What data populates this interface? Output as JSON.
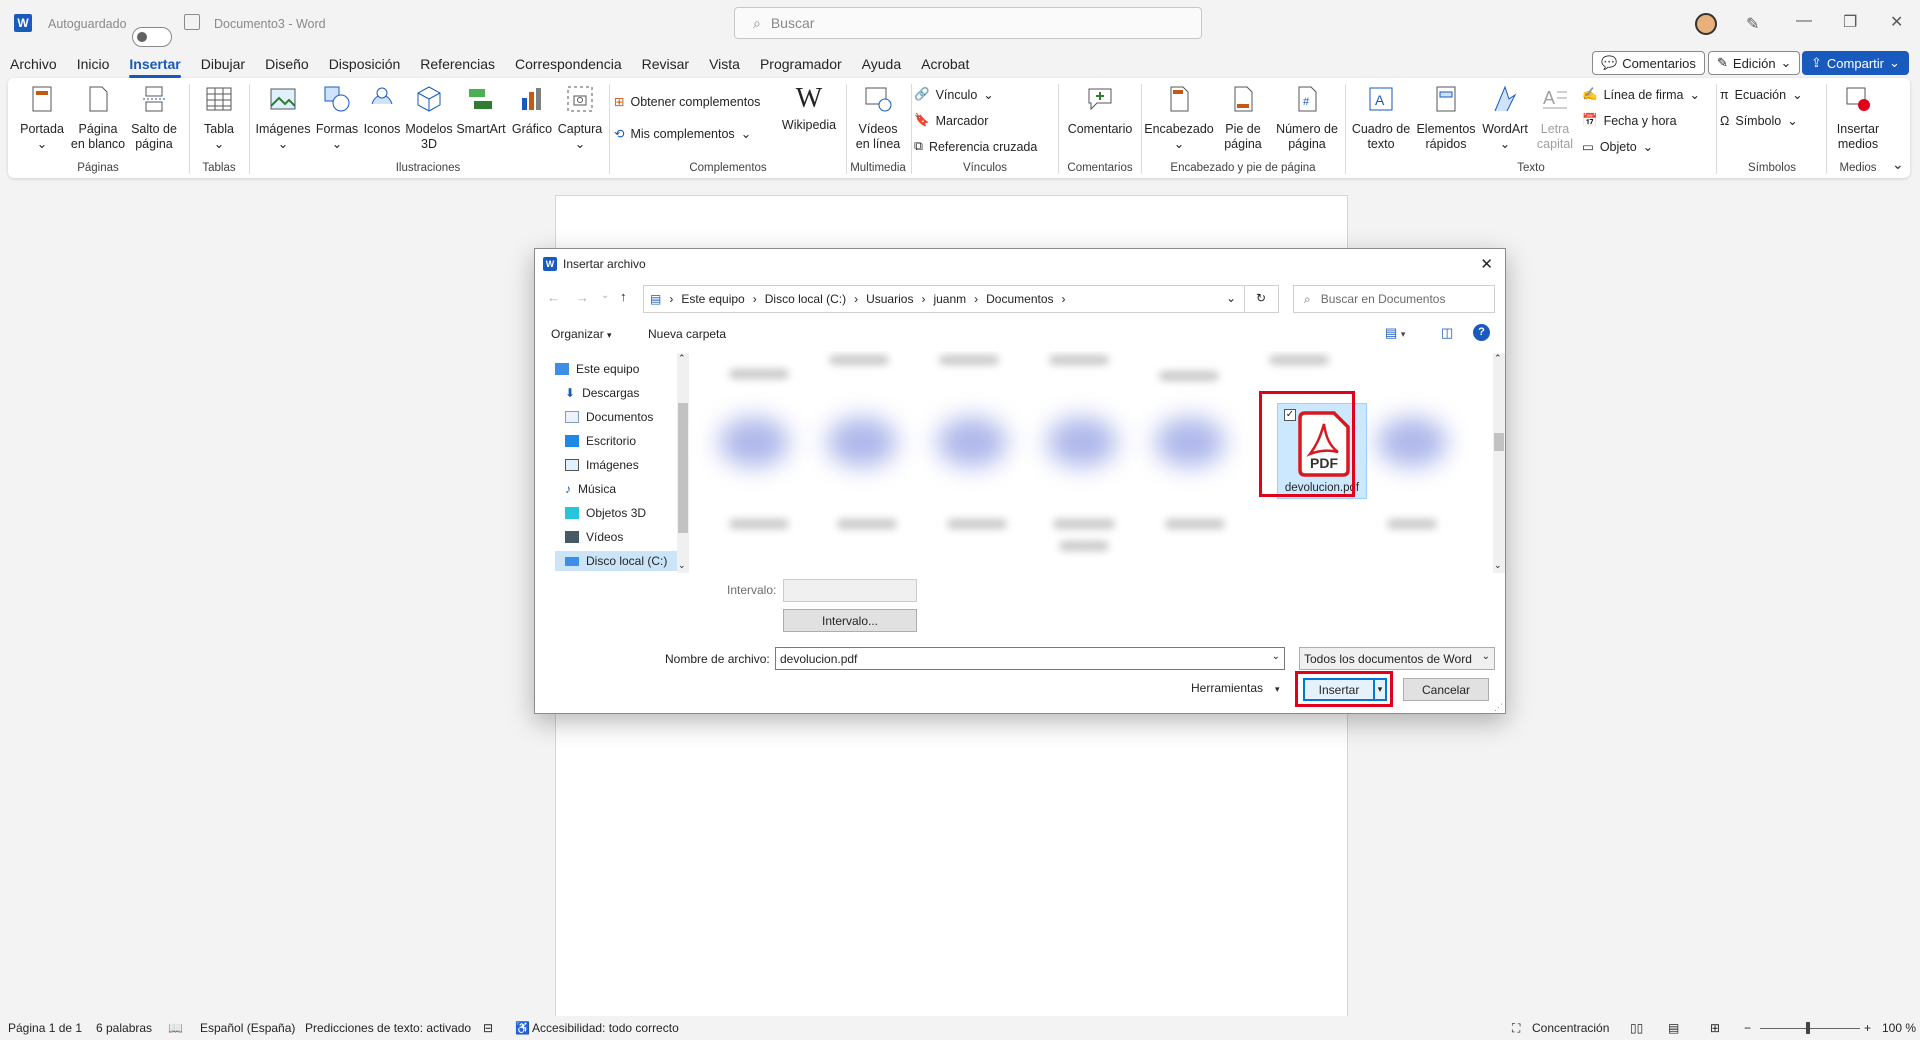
{
  "titlebar": {
    "autosave_label": "Autoguardado",
    "doc_title": "Documento3 - Word",
    "search_placeholder": "Buscar"
  },
  "menu": {
    "tabs": [
      "Archivo",
      "Inicio",
      "Insertar",
      "Dibujar",
      "Diseño",
      "Disposición",
      "Referencias",
      "Correspondencia",
      "Revisar",
      "Vista",
      "Programador",
      "Ayuda",
      "Acrobat"
    ],
    "comments_btn": "Comentarios",
    "edit_btn": "Edición",
    "share_btn": "Compartir"
  },
  "ribbon": {
    "portada": "Portada",
    "pagina_blanco_1": "Página",
    "pagina_blanco_2": "en blanco",
    "salto_1": "Salto de",
    "salto_2": "página",
    "grp_paginas": "Páginas",
    "tabla": "Tabla",
    "grp_tablas": "Tablas",
    "imagenes": "Imágenes",
    "formas": "Formas",
    "iconos": "Iconos",
    "modelos_1": "Modelos",
    "modelos_2": "3D",
    "smartart": "SmartArt",
    "grafico": "Gráfico",
    "captura": "Captura",
    "grp_ilustraciones": "Ilustraciones",
    "obtener": "Obtener complementos",
    "mis": "Mis complementos",
    "wikipedia": "Wikipedia",
    "grp_complementos": "Complementos",
    "videos_1": "Vídeos",
    "videos_2": "en línea",
    "grp_multimedia": "Multimedia",
    "vinculo": "Vínculo",
    "marcador": "Marcador",
    "referencia": "Referencia cruzada",
    "grp_vinculos": "Vínculos",
    "comentario": "Comentario",
    "grp_comentarios": "Comentarios",
    "encabezado": "Encabezado",
    "pie_1": "Pie de",
    "pie_2": "página",
    "numero_1": "Número de",
    "numero_2": "página",
    "grp_encabezado": "Encabezado y pie de página",
    "cuadro_1": "Cuadro de",
    "cuadro_2": "texto",
    "elementos_1": "Elementos",
    "elementos_2": "rápidos",
    "wordart": "WordArt",
    "letra_1": "Letra",
    "letra_2": "capital",
    "linea_firma": "Línea de firma",
    "fecha": "Fecha y hora",
    "objeto": "Objeto",
    "grp_texto": "Texto",
    "ecuacion": "Ecuación",
    "simbolo": "Símbolo",
    "grp_simbolos": "Símbolos",
    "insertar_medios_1": "Insertar",
    "insertar_medios_2": "medios",
    "grp_medios": "Medios"
  },
  "dialog": {
    "title": "Insertar archivo",
    "breadcrumb": [
      "Este equipo",
      "Disco local (C:)",
      "Usuarios",
      "juanm",
      "Documentos"
    ],
    "search_placeholder": "Buscar en Documentos",
    "organizar": "Organizar",
    "nueva_carpeta": "Nueva carpeta",
    "tree": [
      "Este equipo",
      "Descargas",
      "Documentos",
      "Escritorio",
      "Imágenes",
      "Música",
      "Objetos 3D",
      "Vídeos",
      "Disco local (C:)"
    ],
    "selected_file": "devolucion.pdf",
    "pdf_label": "PDF",
    "intervalo_label": "Intervalo:",
    "intervalo_btn": "Intervalo...",
    "nombre_label": "Nombre de archivo:",
    "nombre_value": "devolucion.pdf",
    "filter_value": "Todos los documentos de Word",
    "herramientas": "Herramientas",
    "insertar": "Insertar",
    "cancelar": "Cancelar"
  },
  "status": {
    "pagina": "Página 1 de 1",
    "palabras": "6 palabras",
    "idioma": "Español (España)",
    "predicciones": "Predicciones de texto: activado",
    "accesibilidad": "Accesibilidad: todo correcto",
    "concentracion": "Concentración",
    "zoom": "100 %"
  },
  "colors": {
    "accent": "#185abd",
    "highlight": "#e3001b",
    "pdf_red": "#d71920"
  }
}
